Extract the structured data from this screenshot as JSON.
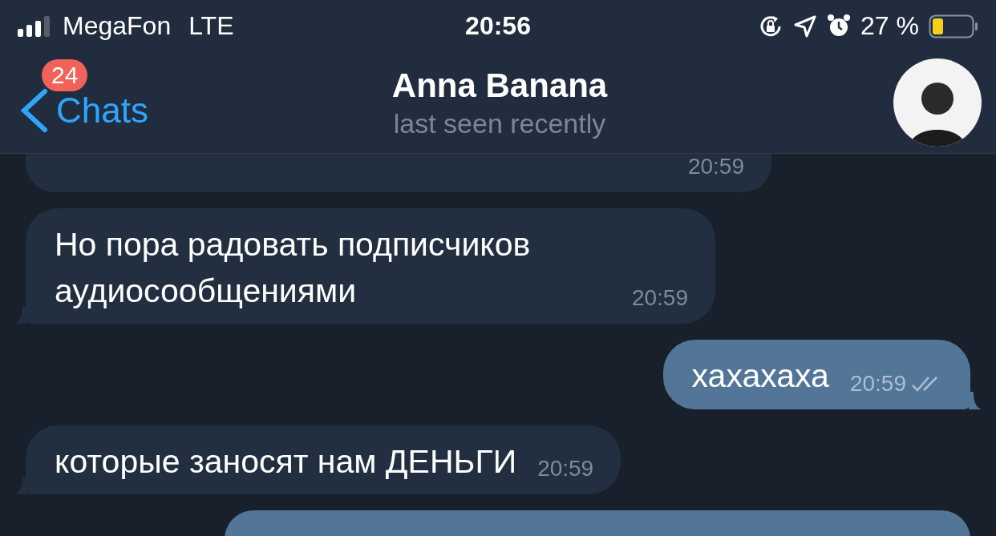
{
  "status_bar": {
    "carrier": "MegaFon",
    "network": "LTE",
    "time": "20:56",
    "battery": "27 %"
  },
  "header": {
    "back_label": "Chats",
    "unread_badge": "24",
    "title": "Anna Banana",
    "subtitle": "last seen recently"
  },
  "messages": [
    {
      "kind": "incoming",
      "time": "20:59",
      "tail": false
    },
    {
      "kind": "incoming",
      "text": "Но пора радовать подписчиков аудиосообщениями",
      "time": "20:59",
      "tail": true
    },
    {
      "kind": "outgoing",
      "text": "хахахаха",
      "time": "20:59",
      "tail": true,
      "read": true
    },
    {
      "kind": "incoming",
      "text": "которые заносят нам ДЕНЬГИ",
      "time": "20:59",
      "tail": true
    },
    {
      "kind": "outgoing",
      "tail": false
    }
  ]
}
